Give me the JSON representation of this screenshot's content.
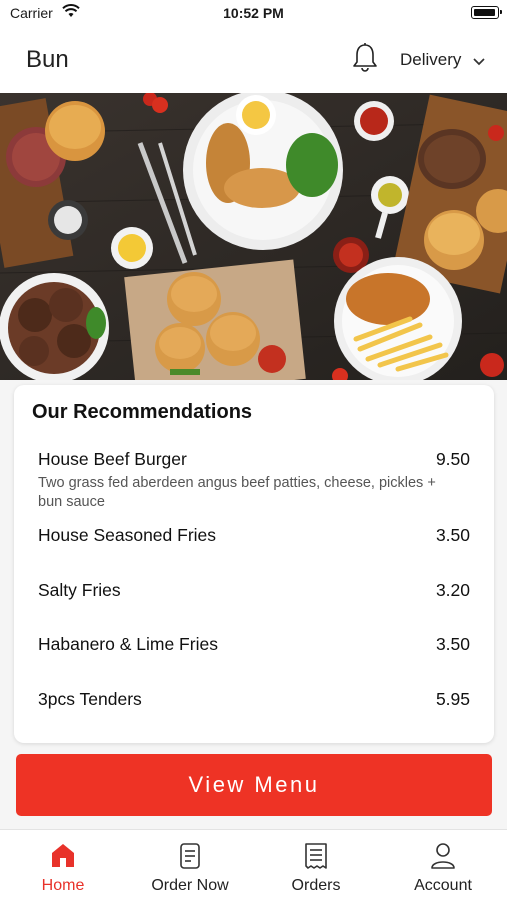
{
  "status_bar": {
    "carrier": "Carrier",
    "time": "10:52 PM"
  },
  "header": {
    "title": "Bun",
    "delivery_label": "Delivery"
  },
  "recommendations": {
    "title": "Our Recommendations",
    "items": [
      {
        "name": "House Beef Burger",
        "price": "9.50",
        "description": "Two grass fed aberdeen angus beef patties, cheese, pickles + bun sauce"
      },
      {
        "name": "House Seasoned Fries",
        "price": "3.50"
      },
      {
        "name": "Salty Fries",
        "price": "3.20"
      },
      {
        "name": "Habanero & Lime Fries",
        "price": "3.50"
      },
      {
        "name": "3pcs Tenders",
        "price": "5.95"
      }
    ]
  },
  "view_menu_label": "View Menu",
  "tabs": [
    {
      "label": "Home",
      "icon": "home-icon",
      "active": true
    },
    {
      "label": "Order Now",
      "icon": "order-icon",
      "active": false
    },
    {
      "label": "Orders",
      "icon": "receipt-icon",
      "active": false
    },
    {
      "label": "Account",
      "icon": "user-icon",
      "active": false
    }
  ],
  "colors": {
    "accent": "#ee3325",
    "active_tab": "#e8322a"
  }
}
